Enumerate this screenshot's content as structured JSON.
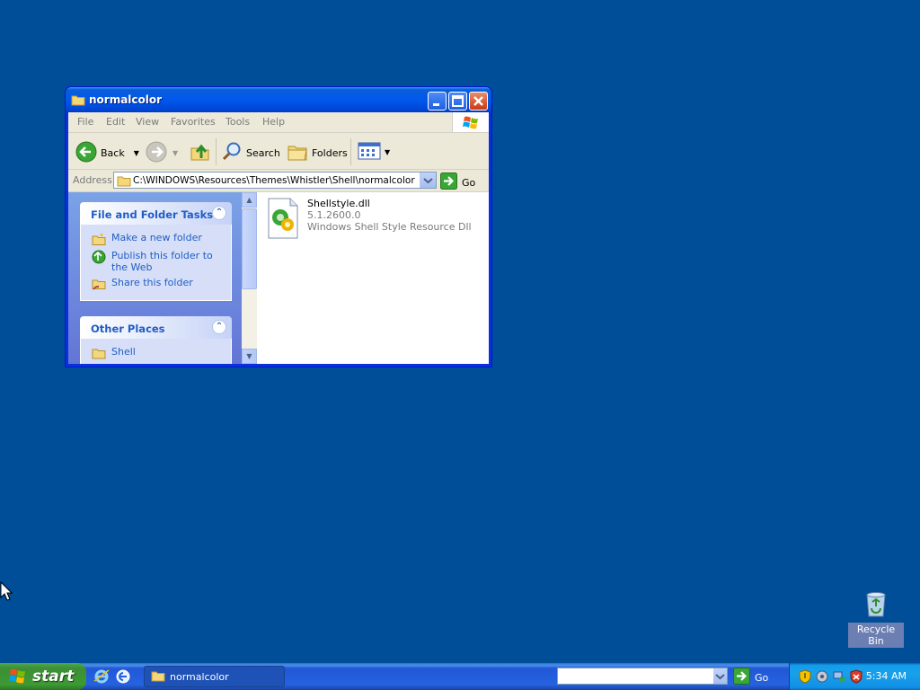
{
  "window": {
    "title": "normalcolor",
    "menu": [
      "File",
      "Edit",
      "View",
      "Favorites",
      "Tools",
      "Help"
    ],
    "toolbar": {
      "back_label": "Back",
      "search_label": "Search",
      "folders_label": "Folders"
    },
    "address": {
      "label": "Address",
      "value": "C:\\WINDOWS\\Resources\\Themes\\Whistler\\Shell\\normalcolor",
      "go_label": "Go"
    },
    "taskpane": {
      "file_tasks": {
        "title": "File and Folder Tasks",
        "items": [
          "Make a new folder",
          "Publish this folder to the Web",
          "Share this folder"
        ]
      },
      "other_places": {
        "title": "Other Places",
        "items": [
          "Shell"
        ]
      }
    },
    "files": [
      {
        "name": "Shellstyle.dll",
        "version": "5.1.2600.0",
        "description": "Windows Shell Style Resource Dll"
      }
    ]
  },
  "desktop": {
    "recycle_bin_label": "Recycle Bin"
  },
  "taskbar": {
    "start_label": "start",
    "task_button_label": "normalcolor",
    "address_value": "",
    "go_label": "Go",
    "clock": "5:34 AM"
  },
  "colors": {
    "desktop": "#004e98",
    "title_bar": "#0058ee",
    "start_button": "#3c9a34",
    "task_link": "#215dc6"
  }
}
